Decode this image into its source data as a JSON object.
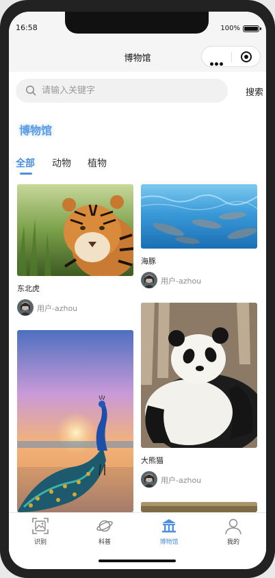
{
  "status": {
    "time": "16:58",
    "battery": "100%"
  },
  "navbar": {
    "title": "博物馆"
  },
  "search": {
    "placeholder": "请输入关键字",
    "button": "搜索"
  },
  "section": {
    "title": "博物馆"
  },
  "tabs": [
    {
      "label": "全部",
      "active": true
    },
    {
      "label": "动物",
      "active": false
    },
    {
      "label": "植物",
      "active": false
    }
  ],
  "cards": [
    {
      "name": "东北虎",
      "user": "用户-azhou"
    },
    {
      "name": "海豚",
      "user": "用户-azhou"
    },
    {
      "name": "大熊猫",
      "user": "用户-azhou"
    }
  ],
  "tabbar": [
    {
      "label": "识别",
      "icon": "scan-image-icon",
      "active": false
    },
    {
      "label": "科普",
      "icon": "planet-icon",
      "active": false
    },
    {
      "label": "博物馆",
      "icon": "museum-icon",
      "active": true
    },
    {
      "label": "我的",
      "icon": "user-icon",
      "active": false
    }
  ],
  "colors": {
    "accent": "#4a90e2",
    "section_title": "#5a9ee6"
  }
}
